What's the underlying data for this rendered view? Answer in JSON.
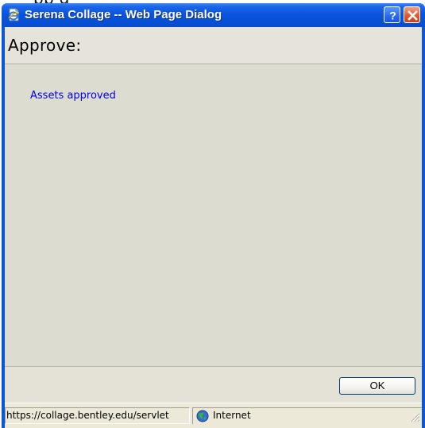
{
  "top_clip_text": "pp  g",
  "window": {
    "title": "Serena Collage -- Web Page Dialog",
    "icon": "ie-page-icon",
    "help_button_label": "?",
    "close_button_icon": "close-icon"
  },
  "dialog": {
    "header_title": "Approve:",
    "message": "Assets approved",
    "ok_label": "OK"
  },
  "status_bar": {
    "url": "https://collage.bentley.edu/servlet",
    "zone_icon": "globe-icon",
    "zone_label": "Internet",
    "grip_icon": "resize-grip-icon"
  },
  "colors": {
    "titlebar": "#0a55de",
    "client_bg": "#ece9d8",
    "content_bg": "#dddcd1",
    "link": "#0000ee",
    "close": "#e2582f"
  }
}
